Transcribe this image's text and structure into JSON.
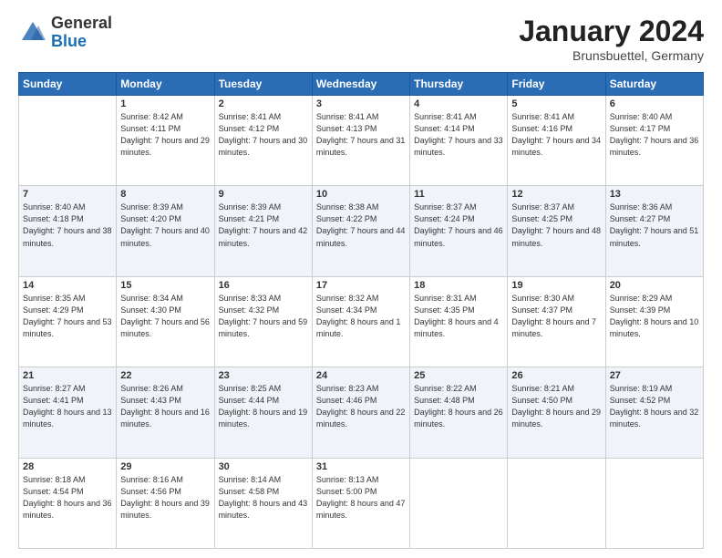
{
  "header": {
    "logo_general": "General",
    "logo_blue": "Blue",
    "month_title": "January 2024",
    "location": "Brunsbuettel, Germany"
  },
  "weekdays": [
    "Sunday",
    "Monday",
    "Tuesday",
    "Wednesday",
    "Thursday",
    "Friday",
    "Saturday"
  ],
  "weeks": [
    [
      {
        "day": "",
        "sunrise": "",
        "sunset": "",
        "daylight": ""
      },
      {
        "day": "1",
        "sunrise": "Sunrise: 8:42 AM",
        "sunset": "Sunset: 4:11 PM",
        "daylight": "Daylight: 7 hours and 29 minutes."
      },
      {
        "day": "2",
        "sunrise": "Sunrise: 8:41 AM",
        "sunset": "Sunset: 4:12 PM",
        "daylight": "Daylight: 7 hours and 30 minutes."
      },
      {
        "day": "3",
        "sunrise": "Sunrise: 8:41 AM",
        "sunset": "Sunset: 4:13 PM",
        "daylight": "Daylight: 7 hours and 31 minutes."
      },
      {
        "day": "4",
        "sunrise": "Sunrise: 8:41 AM",
        "sunset": "Sunset: 4:14 PM",
        "daylight": "Daylight: 7 hours and 33 minutes."
      },
      {
        "day": "5",
        "sunrise": "Sunrise: 8:41 AM",
        "sunset": "Sunset: 4:16 PM",
        "daylight": "Daylight: 7 hours and 34 minutes."
      },
      {
        "day": "6",
        "sunrise": "Sunrise: 8:40 AM",
        "sunset": "Sunset: 4:17 PM",
        "daylight": "Daylight: 7 hours and 36 minutes."
      }
    ],
    [
      {
        "day": "7",
        "sunrise": "Sunrise: 8:40 AM",
        "sunset": "Sunset: 4:18 PM",
        "daylight": "Daylight: 7 hours and 38 minutes."
      },
      {
        "day": "8",
        "sunrise": "Sunrise: 8:39 AM",
        "sunset": "Sunset: 4:20 PM",
        "daylight": "Daylight: 7 hours and 40 minutes."
      },
      {
        "day": "9",
        "sunrise": "Sunrise: 8:39 AM",
        "sunset": "Sunset: 4:21 PM",
        "daylight": "Daylight: 7 hours and 42 minutes."
      },
      {
        "day": "10",
        "sunrise": "Sunrise: 8:38 AM",
        "sunset": "Sunset: 4:22 PM",
        "daylight": "Daylight: 7 hours and 44 minutes."
      },
      {
        "day": "11",
        "sunrise": "Sunrise: 8:37 AM",
        "sunset": "Sunset: 4:24 PM",
        "daylight": "Daylight: 7 hours and 46 minutes."
      },
      {
        "day": "12",
        "sunrise": "Sunrise: 8:37 AM",
        "sunset": "Sunset: 4:25 PM",
        "daylight": "Daylight: 7 hours and 48 minutes."
      },
      {
        "day": "13",
        "sunrise": "Sunrise: 8:36 AM",
        "sunset": "Sunset: 4:27 PM",
        "daylight": "Daylight: 7 hours and 51 minutes."
      }
    ],
    [
      {
        "day": "14",
        "sunrise": "Sunrise: 8:35 AM",
        "sunset": "Sunset: 4:29 PM",
        "daylight": "Daylight: 7 hours and 53 minutes."
      },
      {
        "day": "15",
        "sunrise": "Sunrise: 8:34 AM",
        "sunset": "Sunset: 4:30 PM",
        "daylight": "Daylight: 7 hours and 56 minutes."
      },
      {
        "day": "16",
        "sunrise": "Sunrise: 8:33 AM",
        "sunset": "Sunset: 4:32 PM",
        "daylight": "Daylight: 7 hours and 59 minutes."
      },
      {
        "day": "17",
        "sunrise": "Sunrise: 8:32 AM",
        "sunset": "Sunset: 4:34 PM",
        "daylight": "Daylight: 8 hours and 1 minute."
      },
      {
        "day": "18",
        "sunrise": "Sunrise: 8:31 AM",
        "sunset": "Sunset: 4:35 PM",
        "daylight": "Daylight: 8 hours and 4 minutes."
      },
      {
        "day": "19",
        "sunrise": "Sunrise: 8:30 AM",
        "sunset": "Sunset: 4:37 PM",
        "daylight": "Daylight: 8 hours and 7 minutes."
      },
      {
        "day": "20",
        "sunrise": "Sunrise: 8:29 AM",
        "sunset": "Sunset: 4:39 PM",
        "daylight": "Daylight: 8 hours and 10 minutes."
      }
    ],
    [
      {
        "day": "21",
        "sunrise": "Sunrise: 8:27 AM",
        "sunset": "Sunset: 4:41 PM",
        "daylight": "Daylight: 8 hours and 13 minutes."
      },
      {
        "day": "22",
        "sunrise": "Sunrise: 8:26 AM",
        "sunset": "Sunset: 4:43 PM",
        "daylight": "Daylight: 8 hours and 16 minutes."
      },
      {
        "day": "23",
        "sunrise": "Sunrise: 8:25 AM",
        "sunset": "Sunset: 4:44 PM",
        "daylight": "Daylight: 8 hours and 19 minutes."
      },
      {
        "day": "24",
        "sunrise": "Sunrise: 8:23 AM",
        "sunset": "Sunset: 4:46 PM",
        "daylight": "Daylight: 8 hours and 22 minutes."
      },
      {
        "day": "25",
        "sunrise": "Sunrise: 8:22 AM",
        "sunset": "Sunset: 4:48 PM",
        "daylight": "Daylight: 8 hours and 26 minutes."
      },
      {
        "day": "26",
        "sunrise": "Sunrise: 8:21 AM",
        "sunset": "Sunset: 4:50 PM",
        "daylight": "Daylight: 8 hours and 29 minutes."
      },
      {
        "day": "27",
        "sunrise": "Sunrise: 8:19 AM",
        "sunset": "Sunset: 4:52 PM",
        "daylight": "Daylight: 8 hours and 32 minutes."
      }
    ],
    [
      {
        "day": "28",
        "sunrise": "Sunrise: 8:18 AM",
        "sunset": "Sunset: 4:54 PM",
        "daylight": "Daylight: 8 hours and 36 minutes."
      },
      {
        "day": "29",
        "sunrise": "Sunrise: 8:16 AM",
        "sunset": "Sunset: 4:56 PM",
        "daylight": "Daylight: 8 hours and 39 minutes."
      },
      {
        "day": "30",
        "sunrise": "Sunrise: 8:14 AM",
        "sunset": "Sunset: 4:58 PM",
        "daylight": "Daylight: 8 hours and 43 minutes."
      },
      {
        "day": "31",
        "sunrise": "Sunrise: 8:13 AM",
        "sunset": "Sunset: 5:00 PM",
        "daylight": "Daylight: 8 hours and 47 minutes."
      },
      {
        "day": "",
        "sunrise": "",
        "sunset": "",
        "daylight": ""
      },
      {
        "day": "",
        "sunrise": "",
        "sunset": "",
        "daylight": ""
      },
      {
        "day": "",
        "sunrise": "",
        "sunset": "",
        "daylight": ""
      }
    ]
  ]
}
